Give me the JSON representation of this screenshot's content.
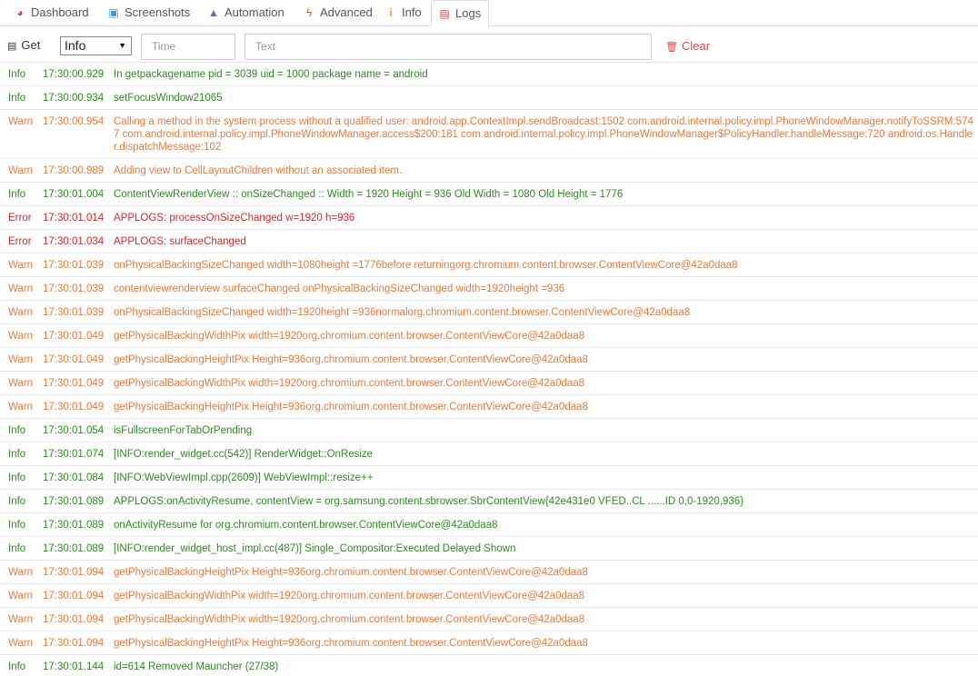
{
  "tabs": [
    {
      "label": "Dashboard",
      "icon": "dashboard-icon",
      "glyph": "◕",
      "color": "#d9346b"
    },
    {
      "label": "Screenshots",
      "icon": "camera-icon",
      "glyph": "▣",
      "color": "#3a9ad9"
    },
    {
      "label": "Automation",
      "icon": "automation-icon",
      "glyph": "▲",
      "color": "#8a4fc9"
    },
    {
      "label": "Advanced",
      "icon": "bolt-icon",
      "glyph": "ϟ",
      "color": "#e8572a"
    },
    {
      "label": "Info",
      "icon": "info-icon",
      "glyph": "i",
      "color": "#f0a020"
    },
    {
      "label": "Logs",
      "icon": "logs-icon",
      "glyph": "▤",
      "color": "#e23c4a"
    }
  ],
  "toolbar": {
    "get_label": "Get",
    "level_selected": "Info",
    "time_placeholder": "Time",
    "text_placeholder": "Text",
    "clear_label": "Clear"
  },
  "logs": [
    {
      "level": "Info",
      "time": "17:30:00.929",
      "message": "In getpackagename pid = 3039 uid = 1000 package name = android"
    },
    {
      "level": "Info",
      "time": "17:30:00.934",
      "message": "setFocusWindow21065"
    },
    {
      "level": "Warn",
      "time": "17:30:00.954",
      "message": "Calling a method in the system process without a qualified user: android.app.ContextImpl.sendBroadcast:1502 com.android.internal.policy.impl.PhoneWindowManager.notifyToSSRM:5747 com.android.internal.policy.impl.PhoneWindowManager.access$200:181 com.android.internal.policy.impl.PhoneWindowManager$PolicyHandler.handleMessage:720 android.os.Handler.dispatchMessage:102"
    },
    {
      "level": "Warn",
      "time": "17:30:00.989",
      "message": "Adding view to CellLayoutChildren without an associated item."
    },
    {
      "level": "Info",
      "time": "17:30:01.004",
      "message": "ContentViewRenderView :: onSizeChanged :: Width = 1920 Height = 936 Old Width = 1080 Old Height = 1776"
    },
    {
      "level": "Error",
      "time": "17:30:01.014",
      "message": "APPLOGS: processOnSizeChanged w=1920 h=936"
    },
    {
      "level": "Error",
      "time": "17:30:01.034",
      "message": "APPLOGS: surfaceChanged"
    },
    {
      "level": "Warn",
      "time": "17:30:01.039",
      "message": "onPhysicalBackingSizeChanged width=1080height =1776before returningorg.chromium.content.browser.ContentViewCore@42a0daa8"
    },
    {
      "level": "Warn",
      "time": "17:30:01.039",
      "message": "contentviewrenderview surfaceChanged onPhysicalBackingSizeChanged width=1920height =936"
    },
    {
      "level": "Warn",
      "time": "17:30:01.039",
      "message": "onPhysicalBackingSizeChanged width=1920height =936normalorg.chromium.content.browser.ContentViewCore@42a0daa8"
    },
    {
      "level": "Warn",
      "time": "17:30:01.049",
      "message": "getPhysicalBackingWidthPix width=1920org.chromium.content.browser.ContentViewCore@42a0daa8"
    },
    {
      "level": "Warn",
      "time": "17:30:01.049",
      "message": "getPhysicalBackingHeightPix Height=936org.chromium.content.browser.ContentViewCore@42a0daa8"
    },
    {
      "level": "Warn",
      "time": "17:30:01.049",
      "message": "getPhysicalBackingWidthPix width=1920org.chromium.content.browser.ContentViewCore@42a0daa8"
    },
    {
      "level": "Warn",
      "time": "17:30:01.049",
      "message": "getPhysicalBackingHeightPix Height=936org.chromium.content.browser.ContentViewCore@42a0daa8"
    },
    {
      "level": "Info",
      "time": "17:30:01.054",
      "message": "isFullscreenForTabOrPending"
    },
    {
      "level": "Info",
      "time": "17:30:01.074",
      "message": "[INFO:render_widget.cc(542)] RenderWidget::OnResize"
    },
    {
      "level": "Info",
      "time": "17:30:01.084",
      "message": "[INFO:WebViewImpl.cpp(2609)] WebViewImpl::resize++"
    },
    {
      "level": "Info",
      "time": "17:30:01.089",
      "message": "APPLOGS:onActivityResume, contentView = org.samsung.content.sbrowser.SbrContentView{42e431e0 VFED..CL ......ID 0,0-1920,936}"
    },
    {
      "level": "Info",
      "time": "17:30:01.089",
      "message": "onActivityResume for org.chromium.content.browser.ContentViewCore@42a0daa8"
    },
    {
      "level": "Info",
      "time": "17:30:01.089",
      "message": "[INFO:render_widget_host_impl.cc(487)] Single_Compositor:Executed Delayed Shown"
    },
    {
      "level": "Warn",
      "time": "17:30:01.094",
      "message": "getPhysicalBackingHeightPix Height=936org.chromium.content.browser.ContentViewCore@42a0daa8"
    },
    {
      "level": "Warn",
      "time": "17:30:01.094",
      "message": "getPhysicalBackingWidthPix width=1920org.chromium.content.browser.ContentViewCore@42a0daa8"
    },
    {
      "level": "Warn",
      "time": "17:30:01.094",
      "message": "getPhysicalBackingWidthPix width=1920org.chromium.content.browser.ContentViewCore@42a0daa8"
    },
    {
      "level": "Warn",
      "time": "17:30:01.094",
      "message": "getPhysicalBackingHeightPix Height=936org.chromium.content.browser.ContentViewCore@42a0daa8"
    },
    {
      "level": "Info",
      "time": "17:30:01.144",
      "message": "id=614 Removed Mauncher (27/38)"
    }
  ],
  "level_colors": {
    "Info": "#2e8b22",
    "Warn": "#f0793a",
    "Error": "#d8262a"
  }
}
